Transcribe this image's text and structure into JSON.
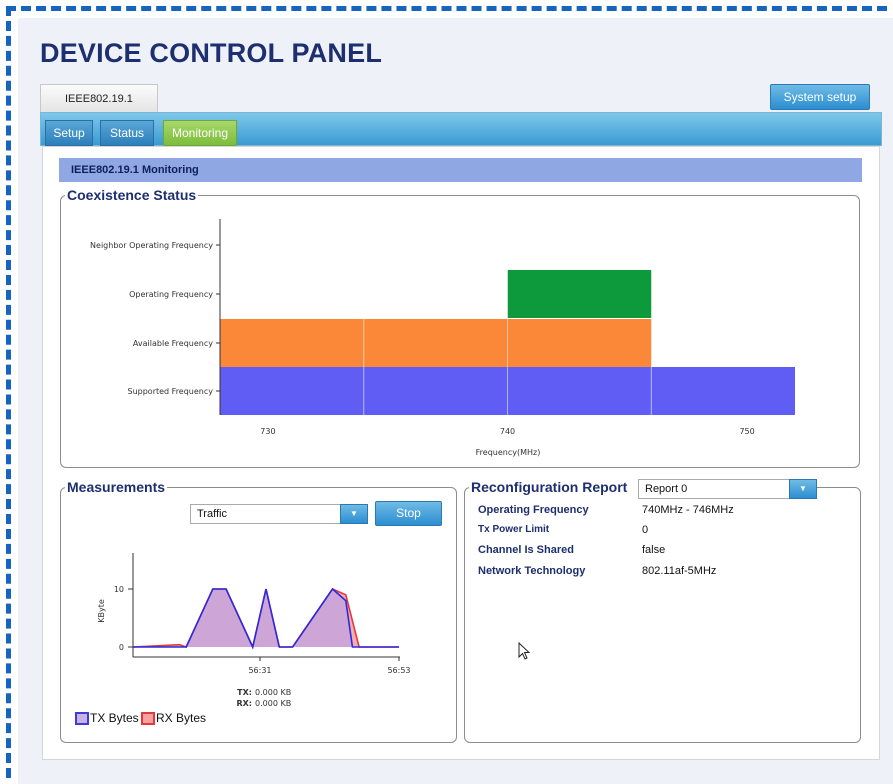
{
  "page_title": "DEVICE CONTROL PANEL",
  "device_tab": "IEEE802.19.1",
  "system_setup_label": "System setup",
  "tabs": [
    {
      "label": "Setup",
      "active": false
    },
    {
      "label": "Status",
      "active": false
    },
    {
      "label": "Monitoring",
      "active": true
    }
  ],
  "monitoring_header": "IEEE802.19.1 Monitoring",
  "coexistence": {
    "legend": "Coexistence Status",
    "chart_data": {
      "type": "bar",
      "orientation": "horizontal-range",
      "categories": [
        "Neighbor Operating Frequency",
        "Operating Frequency",
        "Available Frequency",
        "Supported Frequency"
      ],
      "xlabel": "Frequency(MHz)",
      "xticks": [
        730,
        740,
        750
      ],
      "xlim": [
        728,
        752
      ],
      "bands": [
        {
          "category": "Operating Frequency",
          "ranges": [
            [
              740,
              746
            ]
          ],
          "color": "#0d9a3d"
        },
        {
          "category": "Available Frequency",
          "ranges": [
            [
              728,
              734
            ],
            [
              734,
              740
            ],
            [
              740,
              746
            ]
          ],
          "color": "#fb8838"
        },
        {
          "category": "Supported Frequency",
          "ranges": [
            [
              728,
              734
            ],
            [
              734,
              740
            ],
            [
              740,
              746
            ],
            [
              746,
              752
            ]
          ],
          "color": "#5f5df3"
        }
      ]
    }
  },
  "measurements": {
    "legend": "Measurements",
    "select_value": "Traffic",
    "stop_label": "Stop",
    "y_axis_label": "KByte",
    "y_ticks": [
      "10",
      "0"
    ],
    "x_ticks": [
      "56:31",
      "56:53"
    ],
    "tx_label": "TX:",
    "tx_value": "0.000 KB",
    "rx_label": "RX:",
    "rx_value": "0.000 KB",
    "legend_tx": "TX Bytes",
    "legend_rx": "RX Bytes",
    "chart_data": {
      "type": "area",
      "ylabel": "KByte",
      "ylim": [
        -1,
        16
      ],
      "series": [
        {
          "name": "TX Bytes",
          "color": "#2a2ae0",
          "x": [
            0,
            8,
            12,
            14,
            18,
            20,
            22,
            24,
            30,
            32,
            33,
            36,
            40
          ],
          "values": [
            0,
            0,
            10,
            10,
            0,
            10,
            0,
            0,
            10,
            8,
            0,
            0,
            0
          ]
        },
        {
          "name": "RX Bytes",
          "color": "#e23a3a",
          "x": [
            0,
            7,
            8,
            12,
            14,
            18,
            20,
            22,
            24,
            30,
            32,
            34,
            36,
            40
          ],
          "values": [
            0,
            0.4,
            0,
            10,
            10,
            0,
            10,
            0,
            0,
            10,
            9,
            0,
            0,
            0
          ]
        }
      ]
    }
  },
  "report": {
    "legend": "Reconfiguration Report",
    "select_value": "Report 0",
    "rows": [
      {
        "key": "Operating Frequency",
        "value": "740MHz - 746MHz"
      },
      {
        "key": "Tx Power Limit",
        "value": "0"
      },
      {
        "key": "Channel Is Shared",
        "value": "false"
      },
      {
        "key": "Network Technology",
        "value": "802.11af-5MHz"
      }
    ]
  },
  "colors": {
    "accent": "#2c8ed0",
    "header_bar": "#8fa7e3",
    "title": "#1d2f6f"
  }
}
